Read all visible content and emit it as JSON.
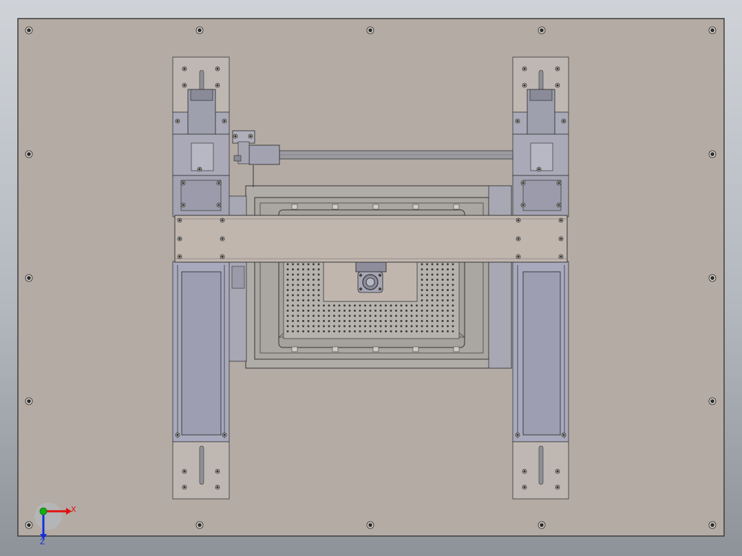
{
  "viewport": {
    "background": "#c4c8cd"
  },
  "colors": {
    "plate": "#b3aba4",
    "plate_edge": "#3a3a3a",
    "rail": "#a9a9bd",
    "rail_dark": "#8c8ca0",
    "block": "#a9a9b8",
    "bridge": "#c0b6ae",
    "tray": "#b0aca7",
    "tray_inner": "#a5a19c",
    "end_block": "#bfb8b2",
    "rod": "#9a9aa0",
    "axis_x": "#e01010",
    "axis_y": "#10b010",
    "axis_z": "#1030e0"
  },
  "triad": {
    "x_label": "X",
    "z_label": "Z",
    "icon": "axis-triad-icon"
  }
}
